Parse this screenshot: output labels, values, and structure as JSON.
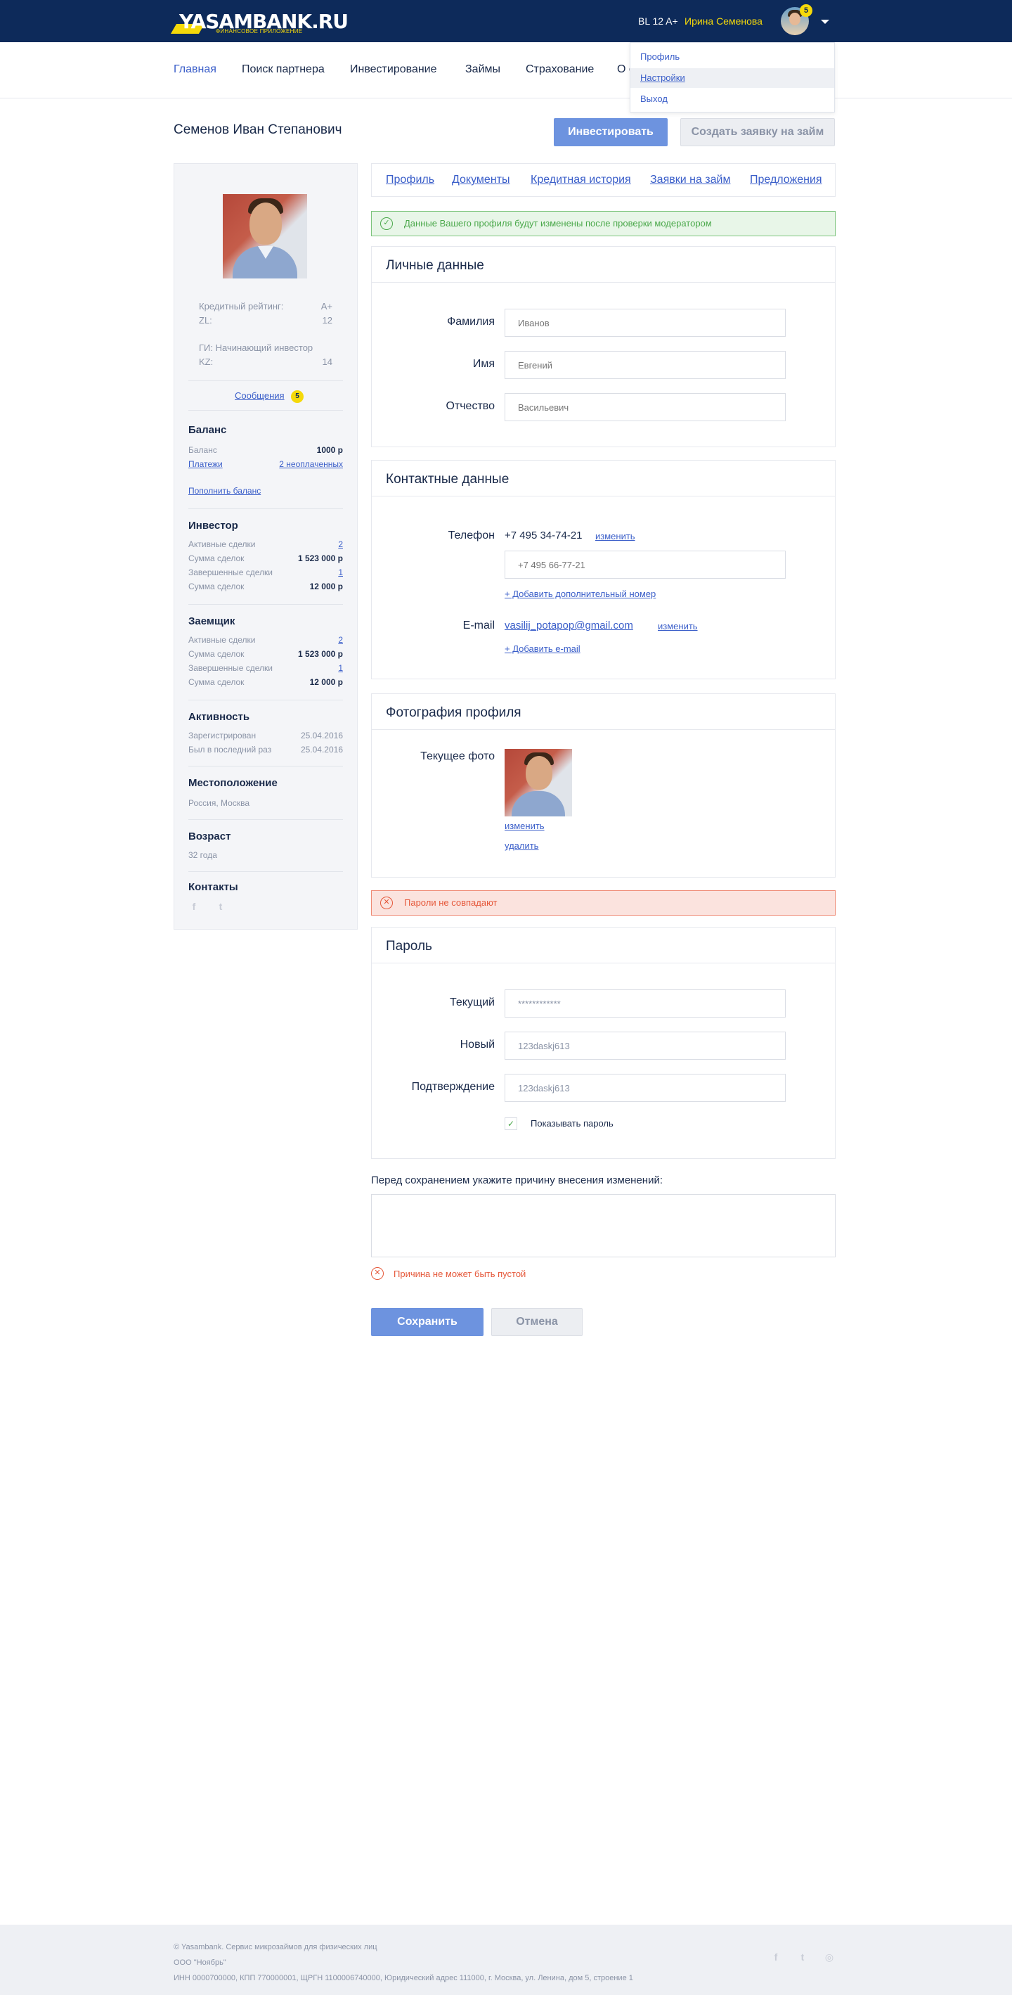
{
  "brand": {
    "logo_text": "YASAMBANK.RU",
    "logo_sub": "ФИНАНСОВОЕ ПРИЛОЖЕНИЕ"
  },
  "user_menu": {
    "rating": "BL 12 A+",
    "name": "Ирина Семенова",
    "notifications": "5",
    "items": [
      "Профиль",
      "Настройки",
      "Выход"
    ]
  },
  "nav": [
    "Главная",
    "Поиск партнера",
    "Инвестирование",
    "Займы",
    "Страхование",
    "О с"
  ],
  "page": {
    "title": "Семенов Иван Степанович",
    "invest_button": "Инвестировать",
    "loan_button": "Создать заявку на займ"
  },
  "sidebar": {
    "credit_rating_label": "Кредитный рейтинг:",
    "credit_rating_value": "A+",
    "zl_label": "ZL:",
    "zl_value": "12",
    "gi_label": "ГИ: Начинающий инвестор",
    "kz_label": "KZ:",
    "kz_value": "14",
    "messages": "Сообщения",
    "messages_count": "5",
    "balance": {
      "title": "Баланс",
      "balance_label": "Баланс",
      "balance_value": "1000 р",
      "payments_link": "Платежи",
      "unpaid_link": "2 неоплаченных",
      "topup_link": "Пополнить баланс"
    },
    "investor": {
      "title": "Инвестор",
      "rows": [
        {
          "label": "Активные сделки",
          "value": "2"
        },
        {
          "label": "Сумма сделок",
          "value": "1 523 000 р"
        },
        {
          "label": "Завершенные сделки",
          "value": "1"
        },
        {
          "label": "Сумма сделок",
          "value": "12 000 р"
        }
      ]
    },
    "borrower": {
      "title": "Заемщик",
      "rows": [
        {
          "label": "Активные сделки",
          "value": "2"
        },
        {
          "label": "Сумма сделок",
          "value": "1 523 000 р"
        },
        {
          "label": "Завершенные сделки",
          "value": "1"
        },
        {
          "label": "Сумма сделок",
          "value": "12 000 р"
        }
      ]
    },
    "activity": {
      "title": "Активность",
      "registered_label": "Зарегистрирован",
      "registered_value": "25.04.2016",
      "last_seen_label": "Был в последний раз",
      "last_seen_value": "25.04.2016"
    },
    "location": {
      "title": "Местоположение",
      "value": "Россия, Москва"
    },
    "age": {
      "title": "Возраст",
      "value": "32 года"
    },
    "contacts": {
      "title": "Контакты"
    }
  },
  "tabs": [
    "Профиль",
    "Документы",
    "Кредитная история",
    "Заявки на займ",
    "Предложения"
  ],
  "alerts": {
    "moderation": "Данные Вашего профиля будут изменены после проверки модератором",
    "password_mismatch": "Пароли не совпадают"
  },
  "personal": {
    "title": "Личные данные",
    "last_name_label": "Фамилия",
    "last_name_placeholder": "Иванов",
    "first_name_label": "Имя",
    "first_name_placeholder": "Евгений",
    "patronymic_label": "Отчество",
    "patronymic_placeholder": "Васильевич"
  },
  "contacts": {
    "title": "Контактные данные",
    "phone_label": "Телефон",
    "phone_value": "+7 495 34-74-21",
    "phone_change": "изменить",
    "phone2_placeholder": "+7 495 66-77-21",
    "add_phone": "+ Добавить дополнительный номер",
    "email_label": "E-mail",
    "email_value": "vasilij_potapop@gmail.com",
    "email_change": "изменить",
    "add_email": "+ Добавить e-mail"
  },
  "photo": {
    "title": "Фотография профиля",
    "current_label": "Текущее фото",
    "change": "изменить",
    "delete": "удалить"
  },
  "password": {
    "title": "Пароль",
    "current_label": "Текущий",
    "current_value": "************",
    "new_label": "Новый",
    "new_value": "123daskj613",
    "confirm_label": "Подтверждение",
    "confirm_value": "123daskj613",
    "show_password": "Показывать пароль"
  },
  "reason": {
    "label": "Перед сохранением укажите причину внесения изменений:",
    "error": "Причина не может быть пустой"
  },
  "actions": {
    "save": "Сохранить",
    "cancel": "Отмена"
  },
  "footer": {
    "line1": "© Yasambank. Сервис микрозаймов для физических лиц",
    "line2": "ООО \"Ноябрь\"",
    "line3": "ИНН 0000700000, КПП 770000001, ЩРГН 1100006740000, Юридический адрес 111000, г. Москва, ул. Ленина, дом 5, строение 1"
  }
}
